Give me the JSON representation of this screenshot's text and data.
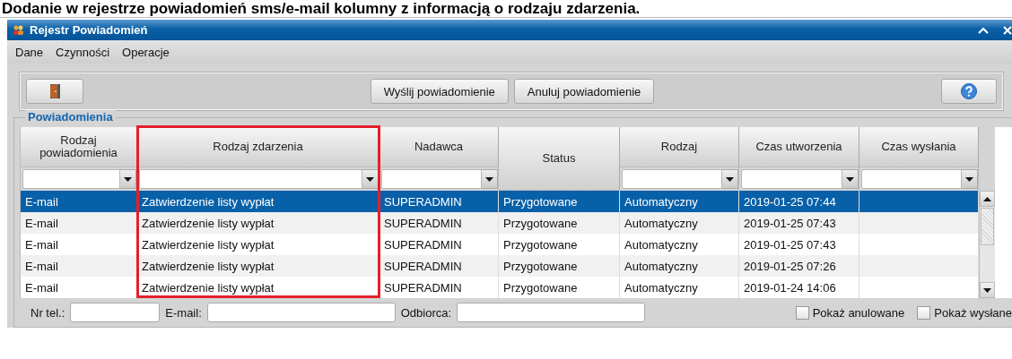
{
  "heading": "Dodanie w rejestrze powiadomień sms/e-mail kolumny z informacją o rodzaju zdarzenia.",
  "window": {
    "title": "Rejestr Powiadomień"
  },
  "menu": [
    "Dane",
    "Czynności",
    "Operacje"
  ],
  "toolbar": {
    "buttons": [
      {
        "kind": "exit"
      },
      {
        "kind": "text",
        "label": "Wyślij powiadomienie"
      },
      {
        "kind": "text",
        "label": "Anuluj powiadomienie"
      },
      {
        "kind": "help"
      }
    ]
  },
  "group": {
    "title": "Powiadomienia"
  },
  "table": {
    "columns": [
      {
        "label": "Rodzaj powiadomienia",
        "filter": true,
        "highlighted": false
      },
      {
        "label": "Rodzaj zdarzenia",
        "filter": true,
        "highlighted": true
      },
      {
        "label": "Nadawca",
        "filter": true,
        "highlighted": false
      },
      {
        "label": "Status",
        "filter": false,
        "highlighted": false
      },
      {
        "label": "Rodzaj",
        "filter": true,
        "highlighted": false
      },
      {
        "label": "Czas utworzenia",
        "filter": true,
        "highlighted": false
      },
      {
        "label": "Czas wysłania",
        "filter": true,
        "highlighted": false
      }
    ],
    "rows": [
      {
        "selected": true,
        "cells": [
          "E-mail",
          "Zatwierdzenie listy wypłat",
          "SUPERADMIN",
          "Przygotowane",
          "Automatyczny",
          "2019-01-25 07:44",
          ""
        ]
      },
      {
        "selected": false,
        "cells": [
          "E-mail",
          "Zatwierdzenie listy wypłat",
          "SUPERADMIN",
          "Przygotowane",
          "Automatyczny",
          "2019-01-25 07:43",
          ""
        ]
      },
      {
        "selected": false,
        "cells": [
          "E-mail",
          "Zatwierdzenie listy wypłat",
          "SUPERADMIN",
          "Przygotowane",
          "Automatyczny",
          "2019-01-25 07:43",
          ""
        ]
      },
      {
        "selected": false,
        "cells": [
          "E-mail",
          "Zatwierdzenie listy wypłat",
          "SUPERADMIN",
          "Przygotowane",
          "Automatyczny",
          "2019-01-25 07:26",
          ""
        ]
      },
      {
        "selected": false,
        "cells": [
          "E-mail",
          "Zatwierdzenie listy wypłat",
          "SUPERADMIN",
          "Przygotowane",
          "Automatyczny",
          "2019-01-24 14:06",
          ""
        ]
      }
    ]
  },
  "footer": {
    "fields": [
      {
        "label": "Nr tel.:"
      },
      {
        "label": "E-mail:"
      },
      {
        "label": "Odbiorca:"
      }
    ],
    "checkboxes": [
      {
        "label": "Pokaż anulowane",
        "checked": false
      },
      {
        "label": "Pokaż wysłane",
        "checked": false
      }
    ]
  }
}
